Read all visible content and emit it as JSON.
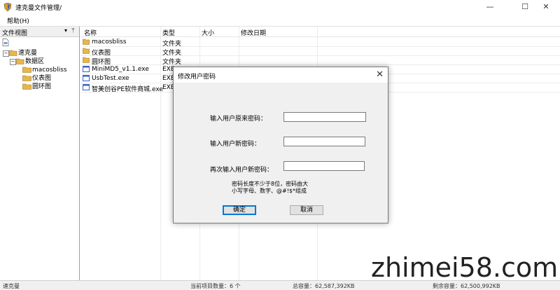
{
  "window": {
    "title": "速克曼文件管理/",
    "minimize_glyph": "—",
    "maximize_glyph": "☐",
    "close_glyph": "✕"
  },
  "menu": {
    "help": "帮助(H)"
  },
  "left_panel": {
    "title": "文件视图",
    "dropdown_glyph": "▾",
    "pin_glyph": "ᛘ",
    "tree": [
      {
        "label": "速克曼"
      },
      {
        "label": "数据区"
      },
      {
        "label": "macosbliss"
      },
      {
        "label": "仪表图"
      },
      {
        "label": "圆环图"
      }
    ]
  },
  "list": {
    "columns": [
      "名称",
      "类型",
      "大小",
      "修改日期"
    ],
    "rows": [
      {
        "name": "macosbliss",
        "type": "文件夹",
        "icon": "folder-icon"
      },
      {
        "name": "仪表图",
        "type": "文件夹",
        "icon": "folder-icon"
      },
      {
        "name": "圆环图",
        "type": "文件夹",
        "icon": "folder-icon"
      },
      {
        "name": "MiniMD5_v1.1.exe",
        "type": "EXE",
        "icon": "exe-icon"
      },
      {
        "name": "UsbTest.exe",
        "type": "EXE",
        "icon": "exe-icon"
      },
      {
        "name": "智美创谷PE软件商城.exe",
        "type": "EXE",
        "icon": "exe-icon"
      }
    ]
  },
  "dialog": {
    "title": "修改用户密码",
    "close_glyph": "✕",
    "old_password_label": "输入用户原来密码：",
    "new_password_label": "输入用户新密码：",
    "confirm_password_label": "再次输入用户新密码：",
    "old_password_value": "",
    "new_password_value": "",
    "confirm_password_value": "",
    "hint_line1": "密码长度不少于8位，密码由大",
    "hint_line2": "小写字母、数字、@#!$*组成",
    "ok_label": "确定",
    "cancel_label": "取消"
  },
  "status": {
    "app": "速克曼",
    "count": "当前项目数量：6 个",
    "total": "总容量：62,587,392KB",
    "free": "剩余容量：62,500,992KB"
  },
  "watermark": "zhimei58.com",
  "colors": {
    "folder": "#e8b64a",
    "accent": "#0078d7"
  }
}
